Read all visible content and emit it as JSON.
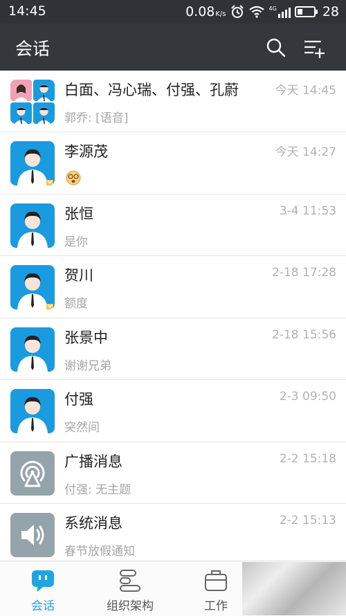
{
  "status_bar": {
    "time": "14:45",
    "speed": "0.08",
    "speed_unit": "K/s",
    "network": "4G",
    "battery": "28"
  },
  "header": {
    "title": "会话"
  },
  "conversations": [
    {
      "name": "白面、冯心瑞、付强、孔蔚",
      "time": "今天 14:45",
      "preview": "郭乔: [语音]",
      "avatar": "group-avatar"
    },
    {
      "name": "李源茂",
      "time": "今天 14:27",
      "preview": "",
      "preview_emoji": "dizzy-face-emoji",
      "avatar": "person-avatar",
      "badge": true
    },
    {
      "name": "张恒",
      "time": "3-4 11:53",
      "preview": "是你",
      "avatar": "person-avatar"
    },
    {
      "name": "贺川",
      "time": "2-18 17:28",
      "preview": "额度",
      "avatar": "person-avatar",
      "badge": true
    },
    {
      "name": "张景中",
      "time": "2-18 15:56",
      "preview": "谢谢兄弟",
      "avatar": "person-avatar"
    },
    {
      "name": "付强",
      "time": "2-3 09:50",
      "preview": "突然间",
      "avatar": "person-avatar"
    },
    {
      "name": "广播消息",
      "time": "2-2 15:18",
      "preview": "付强: 无主题",
      "avatar": "broadcast-avatar"
    },
    {
      "name": "系统消息",
      "time": "2-2 15:13",
      "preview": "春节放假通知",
      "avatar": "speaker-avatar"
    }
  ],
  "tabs": [
    {
      "label": "会话",
      "active": true
    },
    {
      "label": "组织架构",
      "active": false
    },
    {
      "label": "工作",
      "active": false
    }
  ],
  "colors": {
    "accent": "#1ea6e0",
    "header_bg": "#34373c",
    "avatar_blue": "#1a9be0",
    "avatar_gray": "#95a3ab"
  }
}
